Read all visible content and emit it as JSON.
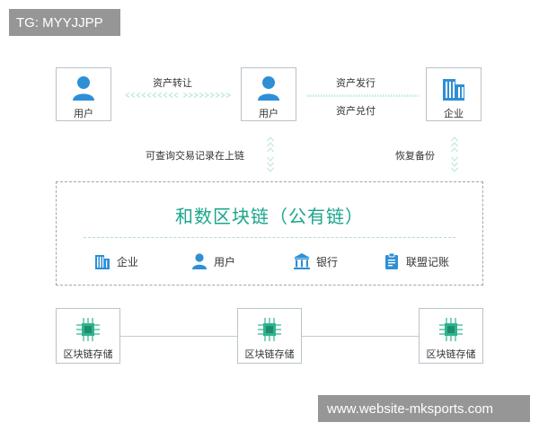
{
  "watermarks": {
    "top_left": "TG: MYYJJPP",
    "bottom_right": "www.website-mksports.com"
  },
  "nodes": {
    "user_1": "用户",
    "user_2": "用户",
    "enterprise": "企业"
  },
  "flows": {
    "transfer": "资产转让",
    "issue": "资产发行",
    "redeem": "资产兑付",
    "query": "可查询交易记录在上链",
    "recover": "恢复备份"
  },
  "chain": {
    "title": "和数区块链（公有链）",
    "members": [
      "企业",
      "用户",
      "银行",
      "联盟记账"
    ]
  },
  "storage": {
    "nodes": [
      "区块链存储",
      "区块链存储",
      "区块链存储"
    ]
  },
  "colors": {
    "accent": "#1aa68c",
    "icon_blue": "#2e8fd6",
    "chip_green": "#2fb38f",
    "border": "#b9c2cb",
    "dash": "#bfe7df"
  },
  "icons": {
    "user": "person-icon",
    "enterprise": "building-icon",
    "bank": "bank-icon",
    "ledger": "clipboard-icon",
    "storage": "chip-icon"
  }
}
